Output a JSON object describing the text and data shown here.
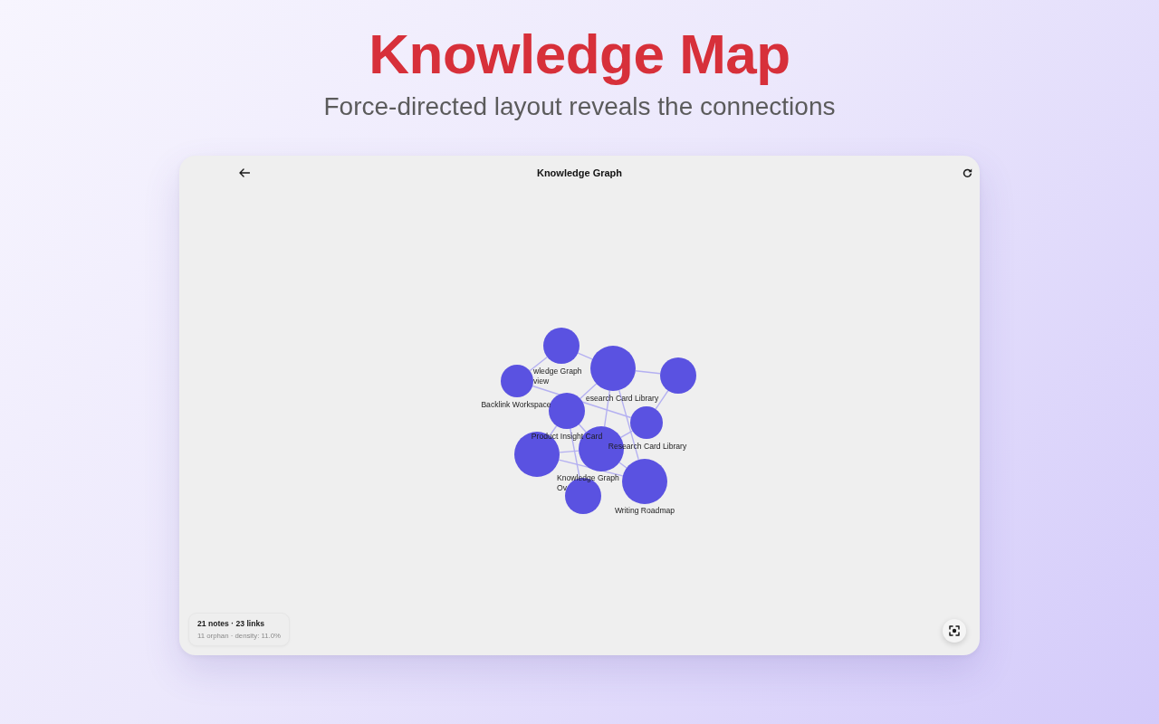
{
  "page": {
    "title": "Knowledge Map",
    "subtitle": "Force-directed layout reveals the connections"
  },
  "window": {
    "title": "Knowledge Graph"
  },
  "graph": {
    "node_labels": [
      {
        "lines": [
          "wledge Graph",
          "view"
        ]
      },
      {
        "lines": [
          "esearch Card Library"
        ]
      },
      {
        "lines": [
          "Backlink Workspace"
        ]
      },
      {
        "lines": [
          "Product Insight Card"
        ]
      },
      {
        "lines": [
          "Research Card Library"
        ]
      },
      {
        "lines": [
          "Knowledge Graph",
          "Ov"
        ]
      },
      {
        "lines": [
          "Writing Roadmap"
        ]
      }
    ]
  },
  "stats": {
    "summary": "21 notes · 23 links",
    "details": "11 orphan · density: 11.0%"
  }
}
